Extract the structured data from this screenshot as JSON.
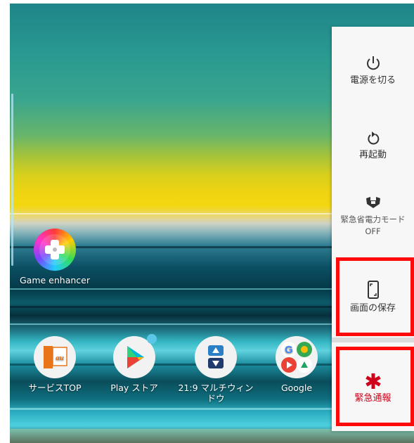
{
  "power_menu": {
    "power_off": "電源を切る",
    "restart": "再起動",
    "stamina": "緊急省電力モード",
    "stamina_state": "OFF",
    "screenshot": "画面の保存",
    "emergency": "緊急通報",
    "accent_red": "#ff0a0a",
    "emergency_color": "#d0021b"
  },
  "home": {
    "game_enhancer": "Game enhancer",
    "dock": [
      {
        "label": "サービスTOP",
        "icon": "au-icon"
      },
      {
        "label": "Play ストア",
        "icon": "play-store-icon"
      },
      {
        "label": "21:9 マルチウィンドウ",
        "icon": "multi-window-icon"
      },
      {
        "label": "Google",
        "icon": "google-folder-icon"
      }
    ]
  }
}
